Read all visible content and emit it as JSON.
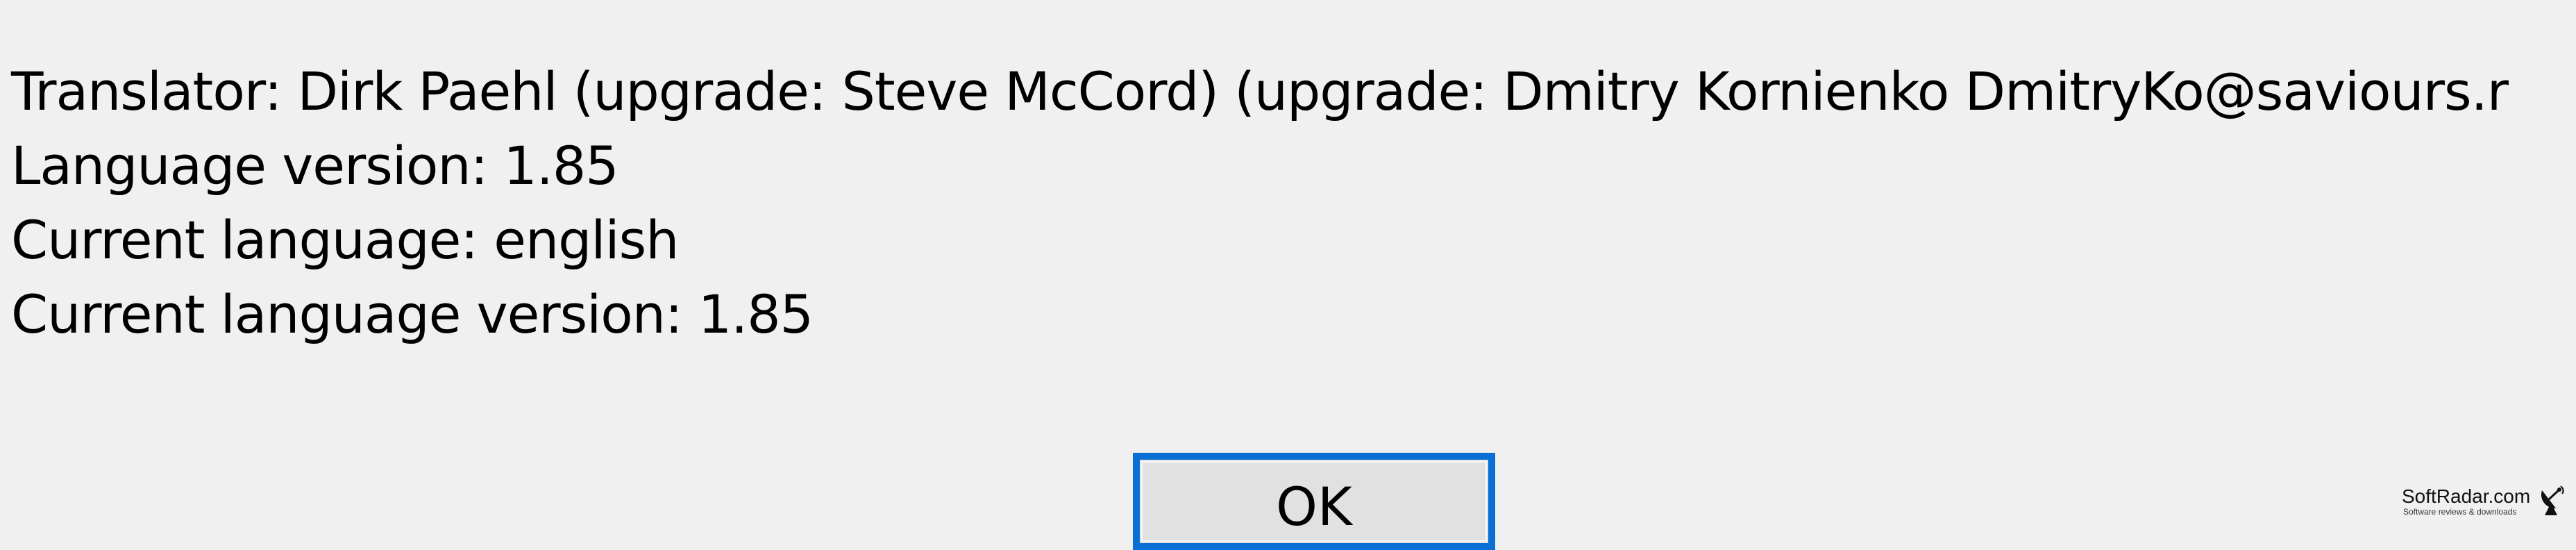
{
  "about": {
    "translator": "Translator: Dirk Paehl (upgrade: Steve McCord) (upgrade: Dmitry Kornienko DmitryKo@saviours.r",
    "language_version": "Language version: 1.85",
    "current_language": "Current language: english",
    "current_language_version": "Current language version: 1.85"
  },
  "buttons": {
    "ok_label": "OK"
  },
  "watermark": {
    "brand": "SoftRadar.com",
    "tagline": "Software reviews & downloads",
    "icon": "satellite-dish-icon"
  },
  "colors": {
    "background": "#f0f0f0",
    "button_focus_border": "#0a6fd4",
    "button_face": "#e1e1e1"
  }
}
